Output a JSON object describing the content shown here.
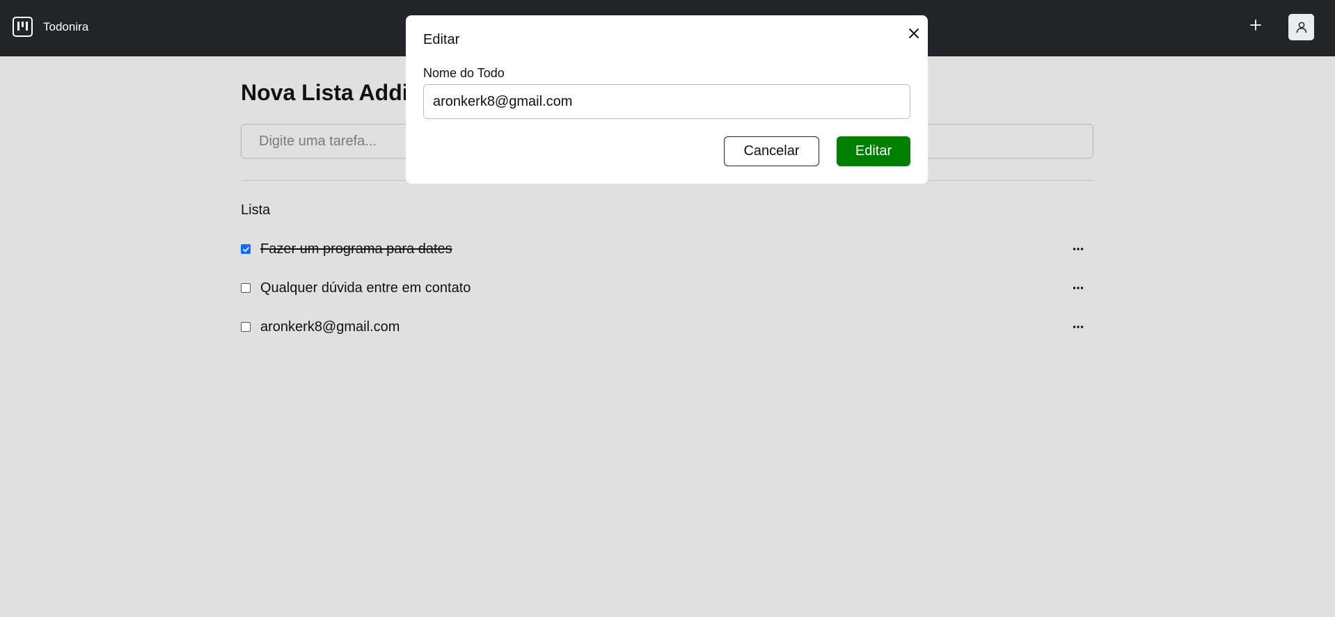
{
  "app": {
    "name": "Todonira",
    "logo_icon": "kanban-board-icon",
    "add_icon": "plus-icon",
    "profile_icon": "user-icon"
  },
  "page": {
    "title": "Nova Lista Addin",
    "input_placeholder": "Digite uma tarefa...",
    "section_label": "Lista"
  },
  "todos": [
    {
      "text": "Fazer um programa para dates",
      "checked": true
    },
    {
      "text": "Qualquer dúvida entre em contato",
      "checked": false
    },
    {
      "text": "aronkerk8@gmail.com",
      "checked": false
    }
  ],
  "todo_menu_icon": "ellipsis-icon",
  "modal": {
    "title": "Editar",
    "close_icon": "close-icon",
    "field_label": "Nome do Todo",
    "field_value": "aronkerk8@gmail.com",
    "cancel_label": "Cancelar",
    "save_label": "Editar"
  },
  "colors": {
    "topbar": "#212529",
    "page_background": "#e0e0e0",
    "primary_action": "#007f00",
    "checkbox_checked": "#0d6efd"
  }
}
